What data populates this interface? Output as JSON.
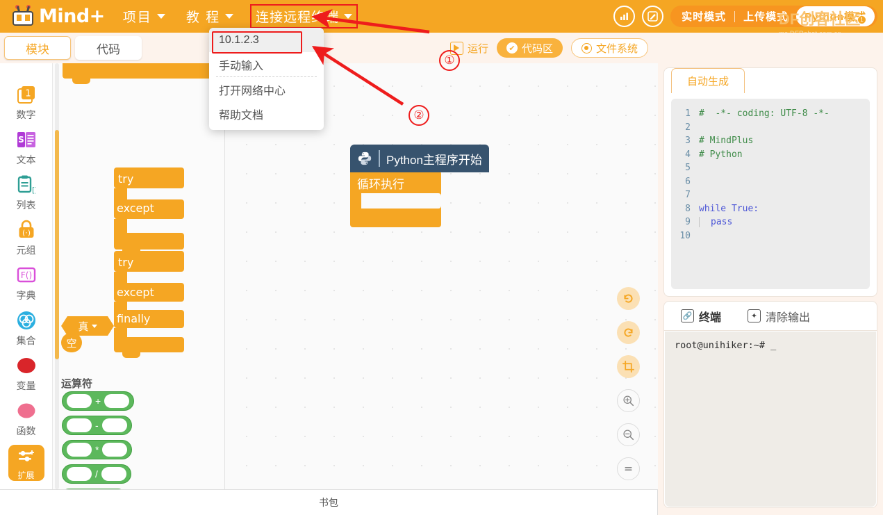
{
  "header": {
    "logo_text": "Mind+",
    "menus": [
      {
        "label": "项目",
        "name": "menu-project"
      },
      {
        "label": "教 程",
        "name": "menu-tutorial"
      },
      {
        "label": "连接远程终端",
        "name": "menu-connect-remote-terminal",
        "highlighted": true
      }
    ],
    "icons": [
      {
        "name": "chart-icon",
        "glyph": "ὌA"
      },
      {
        "name": "edit-icon",
        "glyph": "✎"
      }
    ],
    "modes": {
      "realtime": "实时模式",
      "upload": "上传模式",
      "python": "Python模式"
    },
    "watermark": {
      "title": "DF创客社区",
      "url": "mc.DFRobot.com.cn",
      "badge": "1"
    }
  },
  "dropdown": {
    "items": [
      {
        "label": "10.1.2.3",
        "selected": true,
        "name": "dropdown-item-ip"
      },
      {
        "label": "手动输入",
        "selected": false,
        "name": "dropdown-item-manual-input"
      },
      {
        "label": "打开网络中心",
        "selected": false,
        "name": "dropdown-item-network-center"
      },
      {
        "label": "帮助文档",
        "selected": false,
        "name": "dropdown-item-help-doc"
      }
    ]
  },
  "tabbar": {
    "left_tabs": [
      {
        "label": "模块",
        "active": true
      },
      {
        "label": "代码",
        "active": false
      }
    ],
    "run_label": "运行",
    "code_area_label": "代码区",
    "filesystem_label": "文件系统"
  },
  "categories": [
    {
      "label": "数字",
      "color": "#f5a623"
    },
    {
      "label": "文本",
      "color": "#b03ad6"
    },
    {
      "label": "列表",
      "color": "#2e9e94"
    },
    {
      "label": "元组",
      "color": "#f5a623"
    },
    {
      "label": "字典",
      "color": "#d94fd9"
    },
    {
      "label": "集合",
      "color": "#2bafe0"
    },
    {
      "label": "变量",
      "color": "#d9252a"
    },
    {
      "label": "函数",
      "color": "#ef6f8f"
    },
    {
      "label": "扩展",
      "color": "#f5a623"
    }
  ],
  "palette": {
    "blocks": [
      {
        "labels": [
          "try",
          "except"
        ]
      },
      {
        "labels": [
          "try",
          "except",
          "finally"
        ]
      }
    ],
    "bool_block": "真",
    "none_block": "空",
    "operator_section": "运算符",
    "operators": [
      "+",
      "-",
      "*",
      "/"
    ]
  },
  "canvas": {
    "hat_block": "Python主程序开始",
    "loop_block": "循环执行",
    "controls": [
      {
        "name": "undo-button",
        "glyph": "↺"
      },
      {
        "name": "redo-button",
        "glyph": "↻"
      },
      {
        "name": "fit-button",
        "glyph": "⌗"
      },
      {
        "name": "zoom-in-button",
        "glyph": "+"
      },
      {
        "name": "zoom-out-button",
        "glyph": "−"
      },
      {
        "name": "zoom-reset-button",
        "glyph": "="
      }
    ]
  },
  "bottombar": {
    "label": "书包"
  },
  "code_panel": {
    "tab_label": "自动生成",
    "lines": [
      {
        "num": "1",
        "text": "#  -*- coding: UTF-8 -*-",
        "style": "comment",
        "indent": 0
      },
      {
        "num": "2",
        "text": "",
        "style": "plain",
        "indent": 0
      },
      {
        "num": "3",
        "text": "# MindPlus",
        "style": "comment",
        "indent": 0
      },
      {
        "num": "4",
        "text": "# Python",
        "style": "comment",
        "indent": 0
      },
      {
        "num": "5",
        "text": "",
        "style": "plain",
        "indent": 0
      },
      {
        "num": "6",
        "text": "",
        "style": "plain",
        "indent": 0
      },
      {
        "num": "7",
        "text": "",
        "style": "plain",
        "indent": 0
      },
      {
        "num": "8",
        "text": "while True:",
        "style": "keyword",
        "indent": 0
      },
      {
        "num": "9",
        "text": "pass",
        "style": "keyword",
        "indent": 1
      },
      {
        "num": "10",
        "text": "",
        "style": "plain",
        "indent": 0
      }
    ]
  },
  "terminal": {
    "tab_label": "终端",
    "clear_label": "清除输出",
    "prompt": "root@unihiker:~# _"
  },
  "annotations": [
    {
      "label": "①",
      "name": "annotation-marker-1"
    },
    {
      "label": "②",
      "name": "annotation-marker-2"
    }
  ],
  "colors": {
    "brand_orange": "#f5a623",
    "annotation_red": "#ee1c1c",
    "hat_blue": "#37536e",
    "operator_green": "#5cb85c"
  }
}
